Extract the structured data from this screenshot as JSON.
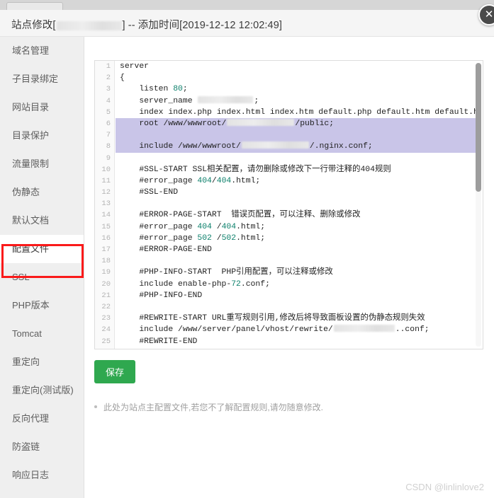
{
  "window": {
    "title_prefix": "站点修改[",
    "title_mid": "] -- 添加时间[",
    "title_time": "2019-12-12 12:02:49",
    "title_suffix": "]",
    "close_label": "✕"
  },
  "sidebar": {
    "items": [
      {
        "label": "域名管理",
        "active": false
      },
      {
        "label": "子目录绑定",
        "active": false
      },
      {
        "label": "网站目录",
        "active": false
      },
      {
        "label": "目录保护",
        "active": false
      },
      {
        "label": "流量限制",
        "active": false
      },
      {
        "label": "伪静态",
        "active": false
      },
      {
        "label": "默认文档",
        "active": false
      },
      {
        "label": "配置文件",
        "active": true
      },
      {
        "label": "SSL",
        "active": false
      },
      {
        "label": "PHP版本",
        "active": false
      },
      {
        "label": "Tomcat",
        "active": false
      },
      {
        "label": "重定向",
        "active": false
      },
      {
        "label": "重定向(测试版)",
        "active": false
      },
      {
        "label": "反向代理",
        "active": false
      },
      {
        "label": "防盗链",
        "active": false
      },
      {
        "label": "响应日志",
        "active": false
      }
    ]
  },
  "editor": {
    "selection_color": "#c9c5e8",
    "lines": [
      {
        "n": 1,
        "text": "server",
        "selected": false
      },
      {
        "n": 2,
        "text": "{",
        "selected": false
      },
      {
        "n": 3,
        "text": "    listen 80;",
        "selected": false
      },
      {
        "n": 4,
        "text": "    server_name [REDACTED];",
        "selected": false
      },
      {
        "n": 5,
        "text": "    index index.php index.html index.htm default.php default.htm default.html;",
        "selected": false
      },
      {
        "n": 6,
        "text": "    root /www/wwwroot/[REDACTED]/public;",
        "selected": true
      },
      {
        "n": 7,
        "text": "",
        "selected": true
      },
      {
        "n": 8,
        "text": "    include /www/wwwroot/[REDACTED]/.nginx.conf;",
        "selected": true
      },
      {
        "n": 9,
        "text": "",
        "selected": false
      },
      {
        "n": 10,
        "text": "    #SSL-START SSL相关配置，请勿删除或修改下一行带注释的404规则",
        "selected": false
      },
      {
        "n": 11,
        "text": "    #error_page 404/404.html;",
        "selected": false
      },
      {
        "n": 12,
        "text": "    #SSL-END",
        "selected": false
      },
      {
        "n": 13,
        "text": "",
        "selected": false
      },
      {
        "n": 14,
        "text": "    #ERROR-PAGE-START  错误页配置，可以注释、删除或修改",
        "selected": false
      },
      {
        "n": 15,
        "text": "    #error_page 404 /404.html;",
        "selected": false
      },
      {
        "n": 16,
        "text": "    #error_page 502 /502.html;",
        "selected": false
      },
      {
        "n": 17,
        "text": "    #ERROR-PAGE-END",
        "selected": false
      },
      {
        "n": 18,
        "text": "",
        "selected": false
      },
      {
        "n": 19,
        "text": "    #PHP-INFO-START  PHP引用配置，可以注释或修改",
        "selected": false
      },
      {
        "n": 20,
        "text": "    include enable-php-72.conf;",
        "selected": false
      },
      {
        "n": 21,
        "text": "    #PHP-INFO-END",
        "selected": false
      },
      {
        "n": 22,
        "text": "",
        "selected": false
      },
      {
        "n": 23,
        "text": "    #REWRITE-START URL重写规则引用,修改后将导致面板设置的伪静态规则失效",
        "selected": false
      },
      {
        "n": 24,
        "text": "    include /www/server/panel/vhost/rewrite/[REDACTED]..conf;",
        "selected": false
      },
      {
        "n": 25,
        "text": "    #REWRITE-END",
        "selected": false
      }
    ]
  },
  "actions": {
    "save_label": "保存"
  },
  "note": {
    "text": "此处为站点主配置文件,若您不了解配置规则,请勿随意修改."
  },
  "watermark": {
    "text": "CSDN @linlinlove2"
  },
  "annotation": {
    "color": "#fa1a1a",
    "target_item": "配置文件"
  }
}
